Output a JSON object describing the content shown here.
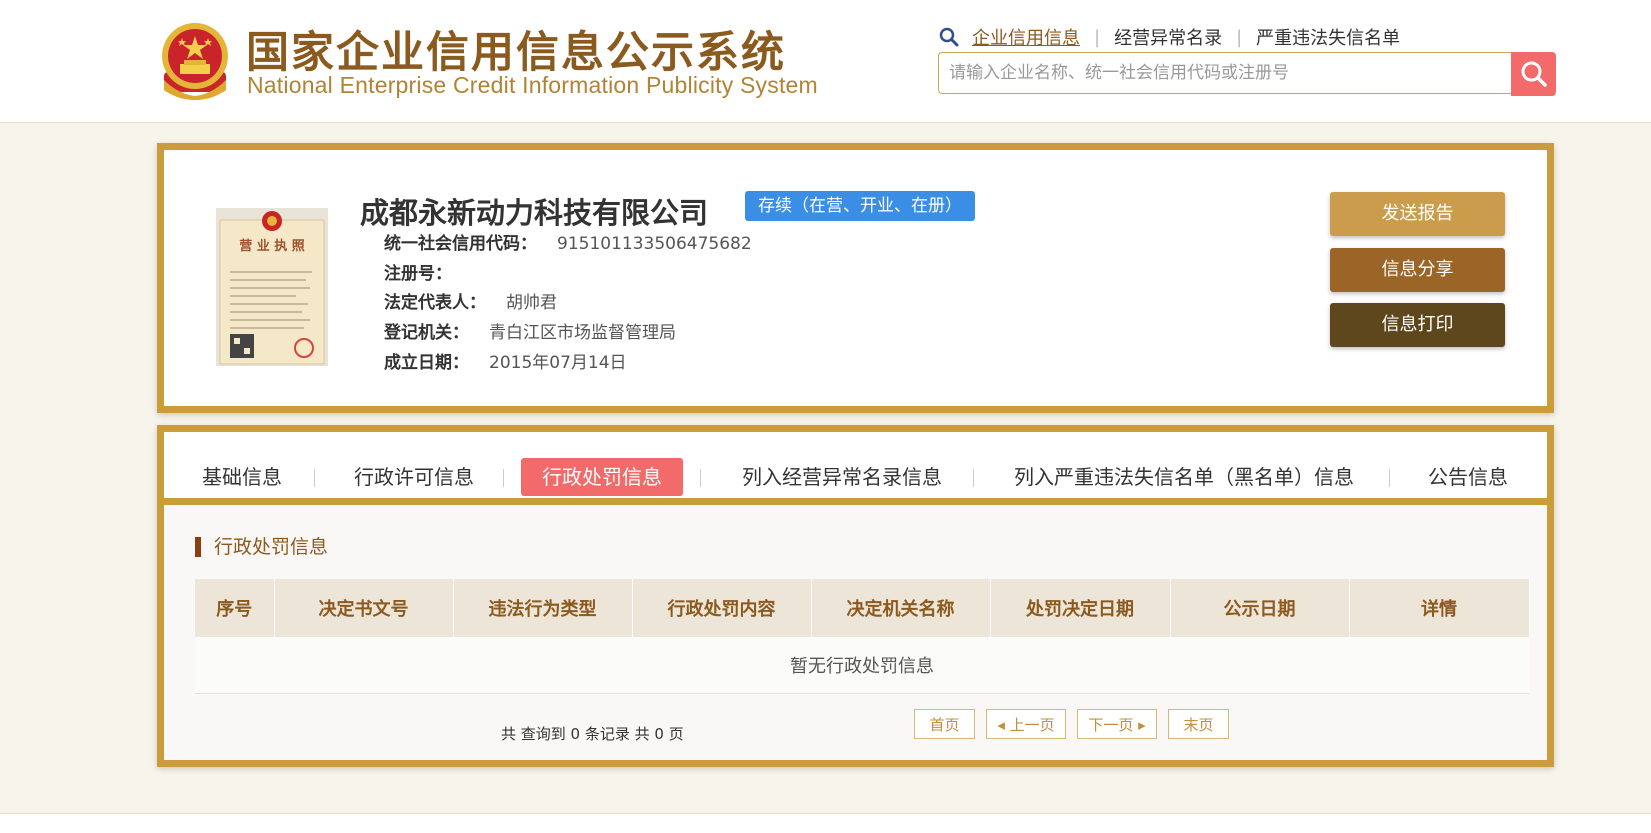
{
  "header": {
    "title_cn": "国家企业信用信息公示系统",
    "title_en": "National Enterprise Credit Information Publicity System",
    "links": [
      "企业信用信息",
      "经营异常名录",
      "严重违法失信名单"
    ],
    "search_placeholder": "请输入企业名称、统一社会信用代码或注册号",
    "icons": {
      "search_link_icon": "magnifier-icon",
      "search_button_icon": "search-icon"
    }
  },
  "company": {
    "name": "成都永新动力科技有限公司",
    "status": "存续（在营、开业、在册）",
    "fields": [
      {
        "label": "统一社会信用代码：",
        "value": "915101133506475682"
      },
      {
        "label": "注册号：",
        "value": ""
      },
      {
        "label": "法定代表人：",
        "value": "胡帅君"
      },
      {
        "label": "登记机关：",
        "value": "青白江区市场监督管理局"
      },
      {
        "label": "成立日期：",
        "value": "2015年07月14日"
      }
    ],
    "license_image": {
      "icon": "business-license-icon",
      "title": "营 业 执 照"
    }
  },
  "actions": {
    "report": "发送报告",
    "share": "信息分享",
    "print": "信息打印"
  },
  "tabs": [
    {
      "label": "基础信息",
      "active": false
    },
    {
      "label": "行政许可信息",
      "active": false
    },
    {
      "label": "行政处罚信息",
      "active": true
    },
    {
      "label": "列入经营异常名录信息",
      "active": false
    },
    {
      "label": "列入严重违法失信名单（黑名单）信息",
      "active": false
    },
    {
      "label": "公告信息",
      "active": false
    }
  ],
  "section": {
    "title": "行政处罚信息",
    "columns": [
      "序号",
      "决定书文号",
      "违法行为类型",
      "行政处罚内容",
      "决定机关名称",
      "处罚决定日期",
      "公示日期",
      "详情"
    ],
    "empty_text": "暂无行政处罚信息"
  },
  "pagination": {
    "summary": "共 查询到 0 条记录 共 0 页",
    "first": "首页",
    "prev": "上一页",
    "next": "下一页",
    "last": "末页"
  },
  "colors": {
    "brand_gold": "#cb9c3b",
    "brand_brown": "#8b5a1e",
    "accent_red": "#f26a6a",
    "status_blue": "#3a8ee6",
    "btn_report": "#cc9c4d",
    "btn_share": "#9a6527",
    "btn_print": "#5e461d"
  }
}
